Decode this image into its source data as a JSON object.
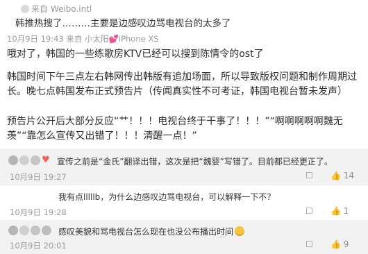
{
  "post": {
    "source": "来自 Weibo.intl",
    "quote": "韩推热搜了………主要是边感叹边骂电视台的太多了",
    "meta": "10月9日 19:43 来自 小太阳💕iPhone XS",
    "p1": "哦对了，韩国的一些练歌房KTV已经可以搜到陈情令的ost了",
    "p2": "韩国时间下午三点左右韩网传出韩版有追加场面，所以导致版权问题和制作周期过长。晚七点韩国发布正式预告片（传闻真实性不可考证，韩国电视台暂未发声）",
    "p3": "预告片公开后大部分反应“艹！！！电视台终于干事了！！！”“啊啊啊啊啊魏无羡”“靠怎么宣传又出错了！！！清醒一点！”"
  },
  "comments": [
    {
      "text": "宣传之前是“金氏”翻译出错，这次是把“魏婴”写错了。目前都已经更正了。",
      "time": "10月9日 19:27",
      "likes": "14"
    },
    {
      "text": "我有点lllllb，为什么边感叹边骂电视台，可以解释一下不？",
      "time": "10月9日 19:28",
      "likes": "1"
    },
    {
      "text": "感叹美貌和骂电视台怎么现在也没公布播出时间",
      "time": "10月9日 20:01",
      "likes": "9"
    }
  ],
  "icons": {
    "reply": "reply-icon",
    "thumb": "thumbs-up-icon",
    "heart": "heart-icon",
    "emoji": "emoji-icon"
  }
}
